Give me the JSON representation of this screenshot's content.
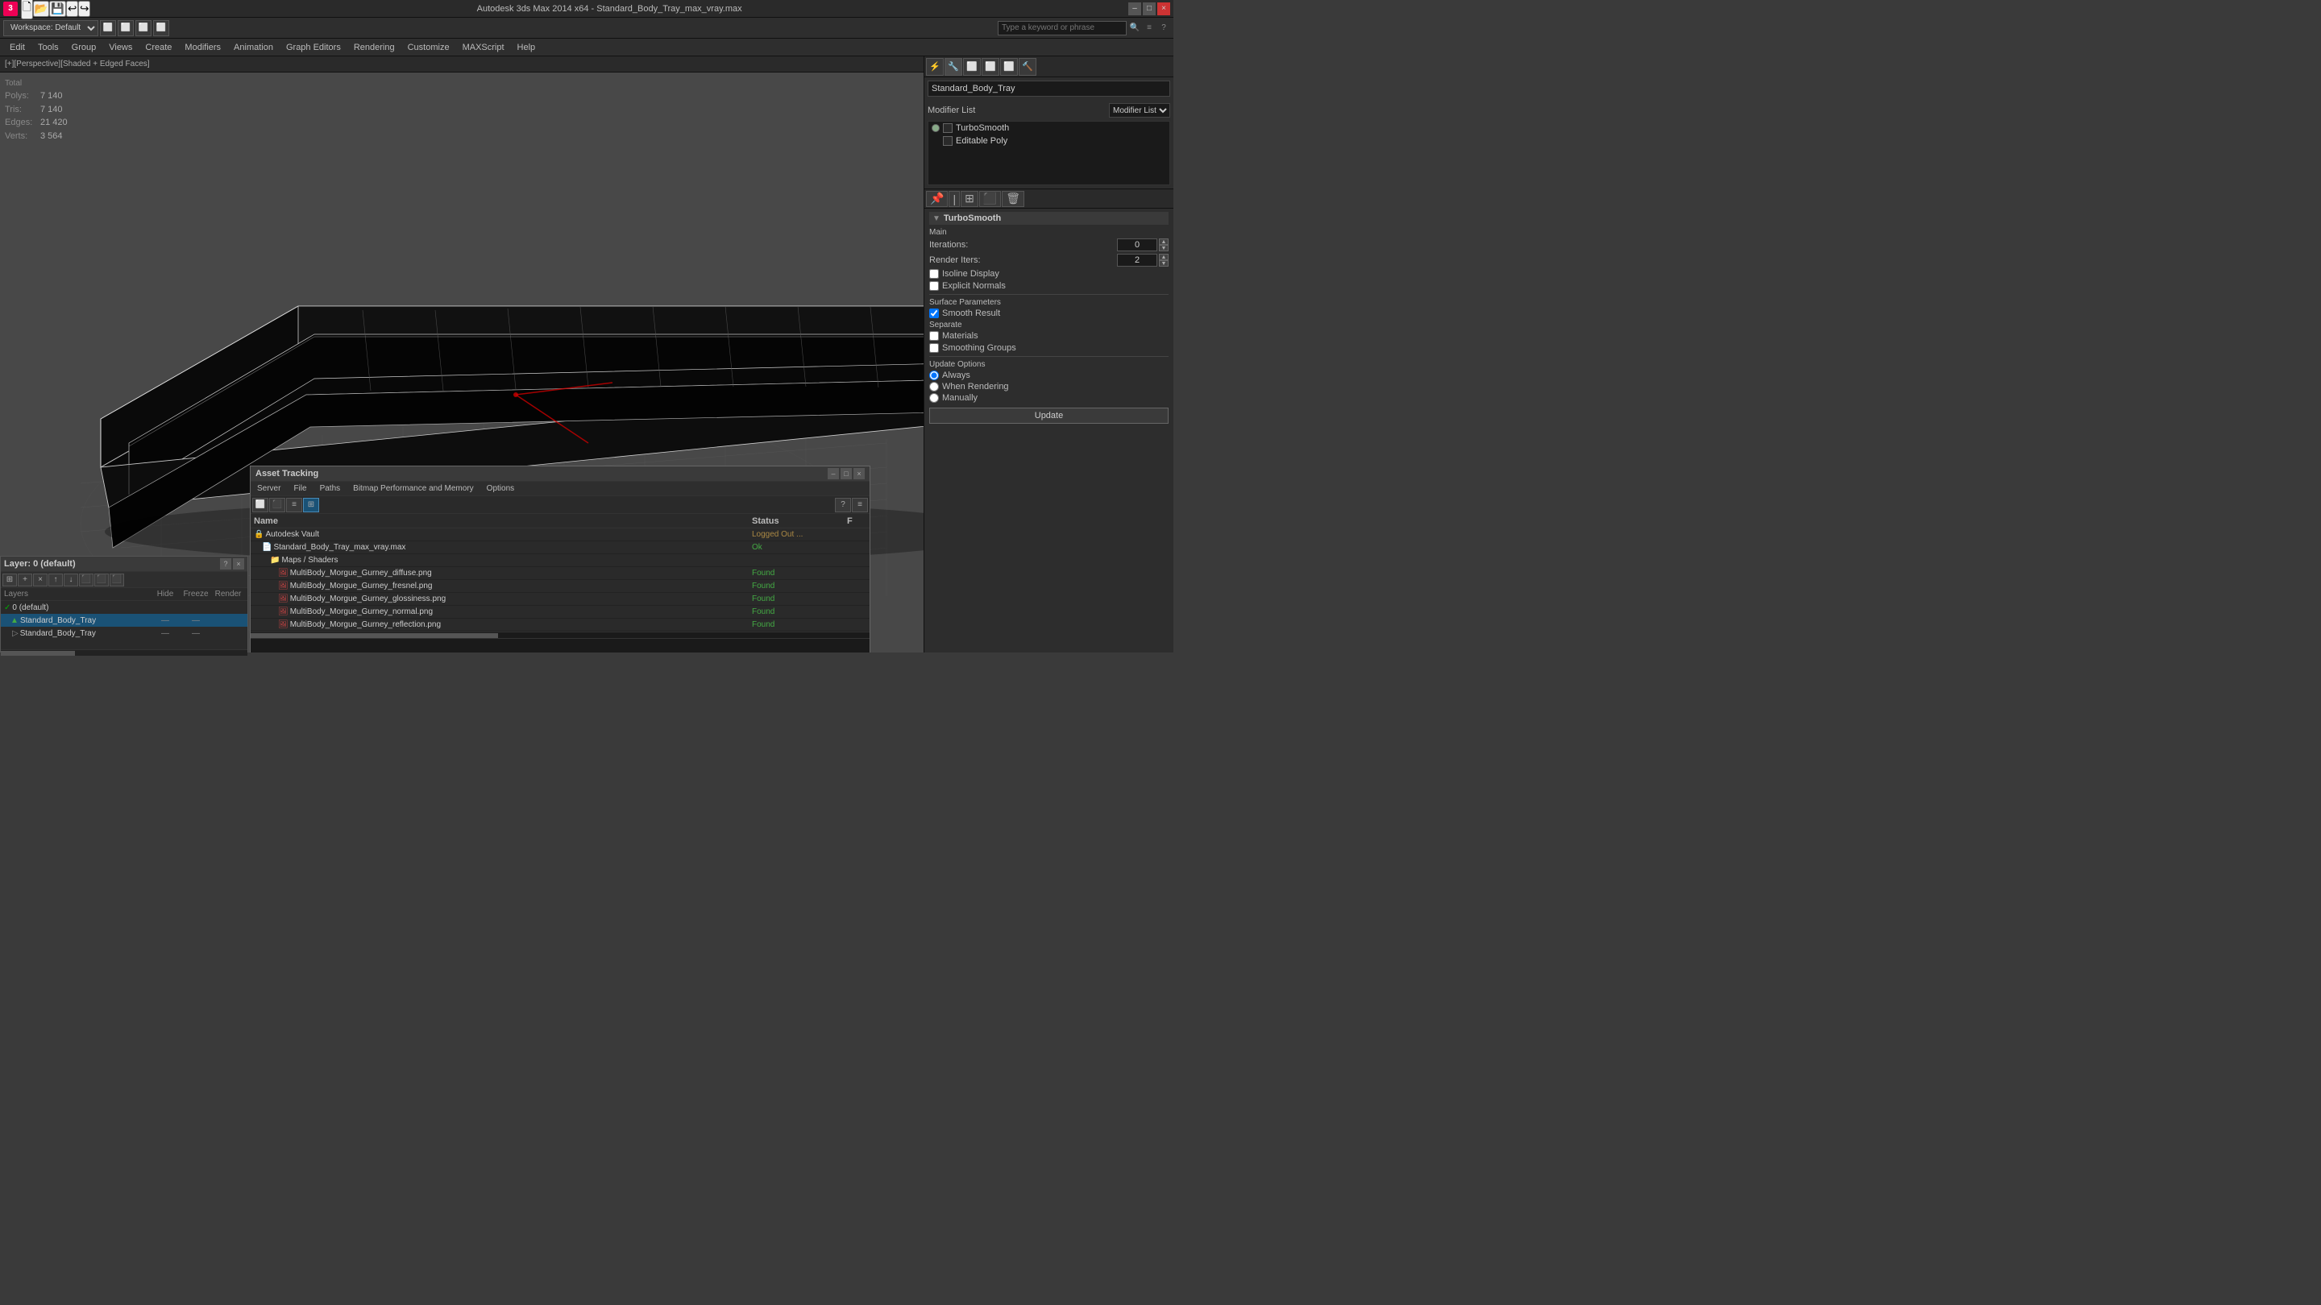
{
  "titlebar": {
    "title": "Autodesk 3ds Max 2014 x64 - Standard_Body_Tray_max_vray.max",
    "minimize_label": "–",
    "maximize_label": "□",
    "close_label": "×",
    "app_icon_label": "3"
  },
  "quickbar": {
    "workspace_label": "Workspace: Default",
    "search_placeholder": "Type a keyword or phrase"
  },
  "menubar": {
    "items": [
      "Edit",
      "Tools",
      "Group",
      "Views",
      "Create",
      "Modifiers",
      "Animation",
      "Graph Editors",
      "Rendering",
      "Customize",
      "MAXScript",
      "Help"
    ]
  },
  "viewport": {
    "label": "[+][Perspective][Shaded + Edged Faces]"
  },
  "stats": {
    "polys_label": "Polys:",
    "polys_value": "7 140",
    "tris_label": "Tris:",
    "tris_value": "7 140",
    "edges_label": "Edges:",
    "edges_value": "21 420",
    "verts_label": "Verts:",
    "verts_value": "3 564",
    "total_label": "Total"
  },
  "right_panel": {
    "obj_name": "Standard_Body_Tray",
    "modifier_list_label": "Modifier List",
    "modifiers": [
      {
        "name": "TurboSmooth",
        "enabled": true,
        "has_bulb": true
      },
      {
        "name": "Editable Poly",
        "enabled": true,
        "has_bulb": false
      }
    ],
    "turbosmooth": {
      "section_title": "TurboSmooth",
      "main_label": "Main",
      "iterations_label": "Iterations:",
      "iterations_value": "0",
      "render_iters_label": "Render Iters:",
      "render_iters_value": "2",
      "isoline_display_label": "Isoline Display",
      "explicit_normals_label": "Explicit Normals",
      "surface_params_label": "Surface Parameters",
      "smooth_result_label": "Smooth Result",
      "smooth_result_checked": true,
      "separate_label": "Separate",
      "materials_label": "Materials",
      "materials_checked": false,
      "smoothing_groups_label": "Smoothing Groups",
      "smoothing_groups_checked": false,
      "update_options_label": "Update Options",
      "always_label": "Always",
      "when_rendering_label": "When Rendering",
      "manually_label": "Manually",
      "update_btn_label": "Update"
    }
  },
  "layers": {
    "title": "Layer: 0 (default)",
    "cols": {
      "name": "Layers",
      "hide": "Hide",
      "freeze": "Freeze",
      "render": "Render"
    },
    "items": [
      {
        "name": "0 (default)",
        "active": true,
        "selected": false,
        "hide": "",
        "freeze": "",
        "render": ""
      },
      {
        "name": "Standard_Body_Tray",
        "active": false,
        "selected": true,
        "hide": "—",
        "freeze": "—",
        "render": ""
      },
      {
        "name": "Standard_Body_Tray",
        "active": false,
        "selected": false,
        "hide": "—",
        "freeze": "—",
        "render": ""
      }
    ]
  },
  "asset_tracking": {
    "title": "Asset Tracking",
    "menu_items": [
      "Server",
      "File",
      "Paths",
      "Bitmap Performance and Memory",
      "Options"
    ],
    "cols": {
      "name": "Name",
      "status": "Status",
      "extra": "F"
    },
    "tree": [
      {
        "level": 0,
        "icon": "folder",
        "name": "Autodesk Vault",
        "status": "Logged Out ...",
        "status_class": "status-logged-out"
      },
      {
        "level": 1,
        "icon": "file",
        "name": "Standard_Body_Tray_max_vray.max",
        "status": "Ok",
        "status_class": "status-ok"
      },
      {
        "level": 2,
        "icon": "folder",
        "name": "Maps / Shaders",
        "status": "",
        "status_class": ""
      },
      {
        "level": 3,
        "icon": "img",
        "name": "MultiBody_Morgue_Gurney_diffuse.png",
        "status": "Found",
        "status_class": "status-found"
      },
      {
        "level": 3,
        "icon": "img",
        "name": "MultiBody_Morgue_Gurney_fresnel.png",
        "status": "Found",
        "status_class": "status-found"
      },
      {
        "level": 3,
        "icon": "img",
        "name": "MultiBody_Morgue_Gurney_glossiness.png",
        "status": "Found",
        "status_class": "status-found"
      },
      {
        "level": 3,
        "icon": "img",
        "name": "MultiBody_Morgue_Gurney_normal.png",
        "status": "Found",
        "status_class": "status-found"
      },
      {
        "level": 3,
        "icon": "img",
        "name": "MultiBody_Morgue_Gurney_reflection.png",
        "status": "Found",
        "status_class": "status-found"
      }
    ]
  }
}
